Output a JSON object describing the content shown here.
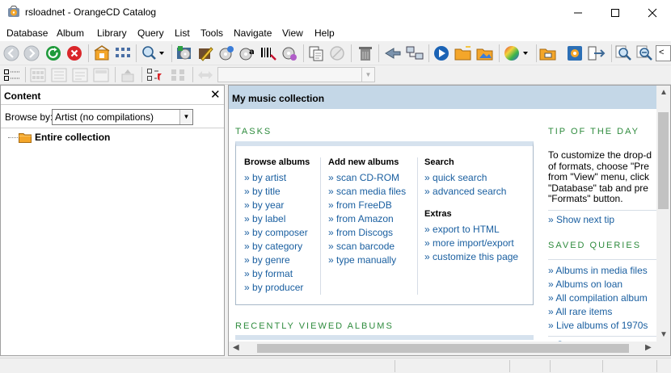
{
  "window": {
    "title": "rsloadnet - OrangeCD Catalog"
  },
  "menu": [
    "Database",
    "Album",
    "Library",
    "Query",
    "List",
    "Tools",
    "Navigate",
    "View",
    "Help"
  ],
  "colors": {
    "accent_green": "#2e8b3d",
    "link_blue": "#1a5fa0",
    "header_blue": "#c4d7e7",
    "folder_orange": "#f4a62a"
  },
  "left_pane": {
    "title": "Content",
    "browse_label": "Browse by:",
    "browse_value": "Artist (no compilations)",
    "tree_root": "Entire collection"
  },
  "right_pane": {
    "title": "My music collection",
    "tasks_heading": "TASKS",
    "tip_heading": "TIP OF THE DAY",
    "saved_heading": "SAVED QUERIES",
    "recent_heading": "RECENTLY VIEWED ALBUMS",
    "bullet": "»",
    "browse_albums": {
      "heading": "Browse albums",
      "links": [
        "by artist",
        "by title",
        "by year",
        "by label",
        "by composer",
        "by category",
        "by genre",
        "by format",
        "by producer"
      ]
    },
    "add_albums": {
      "heading": "Add new albums",
      "links": [
        "scan CD-ROM",
        "scan media files",
        "from FreeDB",
        "from Amazon",
        "from Discogs",
        "scan barcode",
        "type manually"
      ]
    },
    "search": {
      "heading": "Search",
      "links": [
        "quick search",
        "advanced search"
      ]
    },
    "extras": {
      "heading": "Extras",
      "links": [
        "export to HTML",
        "more import/export",
        "customize this page"
      ]
    },
    "tip_lines": [
      "To customize the drop-d",
      "of formats, choose \"Pre",
      "from \"View\" menu, click",
      "\"Database\" tab and pre",
      "\"Formats\" button."
    ],
    "show_next_tip": "Show next tip",
    "saved_queries": [
      "Albums in media files",
      "Albums on loan",
      "All compilation album",
      "All rare items",
      "Live albums of 1970s"
    ],
    "create_new": "Create new query"
  }
}
